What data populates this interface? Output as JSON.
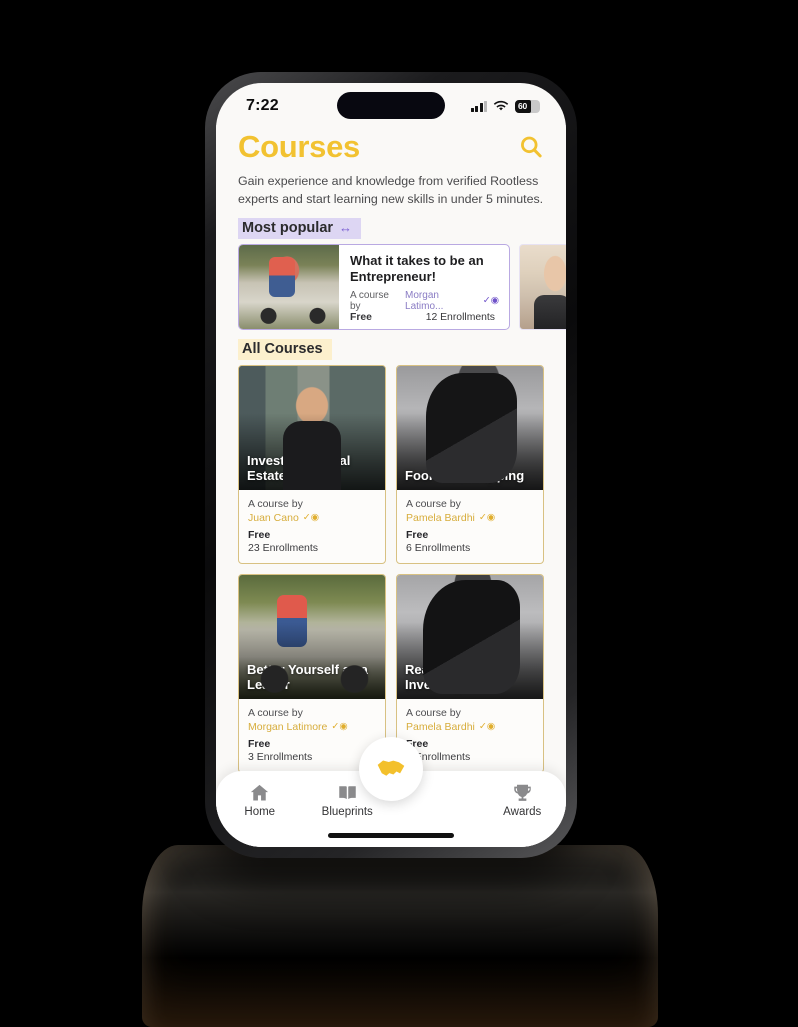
{
  "status_bar": {
    "time": "7:22",
    "battery_level": "60",
    "signal_icon": "cellular-bars-icon",
    "wifi_icon": "wifi-icon",
    "battery_icon": "battery-icon"
  },
  "header": {
    "title": "Courses",
    "title_color": "#f2c231",
    "search_icon": "search-icon"
  },
  "intro": {
    "text": "Gain experience and knowledge from verified Rootless experts and start learning new skills in under 5 minutes."
  },
  "sections": {
    "most_popular": {
      "label": "Most popular",
      "arrows_glyph": "↔",
      "highlight_color": "#ddd6f3",
      "accent_color": "#7a5fd3"
    },
    "all_courses": {
      "label": "All Courses",
      "highlight_color": "#fcf0cd",
      "accent_color": "#d8c182"
    }
  },
  "featured": {
    "card": {
      "title": "What it takes to be an Entrepreneur!",
      "by_label": "A course by",
      "author": "Morgan Latimo...",
      "verified_badge": "verified-badge-icon",
      "price": "Free",
      "enrollments": "12 Enrollments"
    }
  },
  "courses": [
    {
      "title": "Investing in Real Estate",
      "by_label": "A course by",
      "author": "Juan Cano",
      "price": "Free",
      "enrollments": "23 Enrollments"
    },
    {
      "title": "Fool Proof Flipping",
      "by_label": "A course by",
      "author": "Pamela Bardhi",
      "price": "Free",
      "enrollments": "6 Enrollments"
    },
    {
      "title": "Better Yourself as a Leader",
      "by_label": "A course by",
      "author": "Morgan Latimore",
      "price": "Free",
      "enrollments": "3 Enrollments"
    },
    {
      "title": "Real Estate Investing 101",
      "by_label": "A course by",
      "author": "Pamela Bardhi",
      "price": "Free",
      "enrollments": "6 Enrollments"
    }
  ],
  "tabbar": {
    "items": [
      {
        "label": "Home",
        "icon": "home-icon"
      },
      {
        "label": "Blueprints",
        "icon": "book-icon"
      },
      {
        "label": "Awards",
        "icon": "trophy-icon"
      }
    ],
    "fab_icon": "handshake-icon",
    "fab_color": "#f3c02c"
  }
}
